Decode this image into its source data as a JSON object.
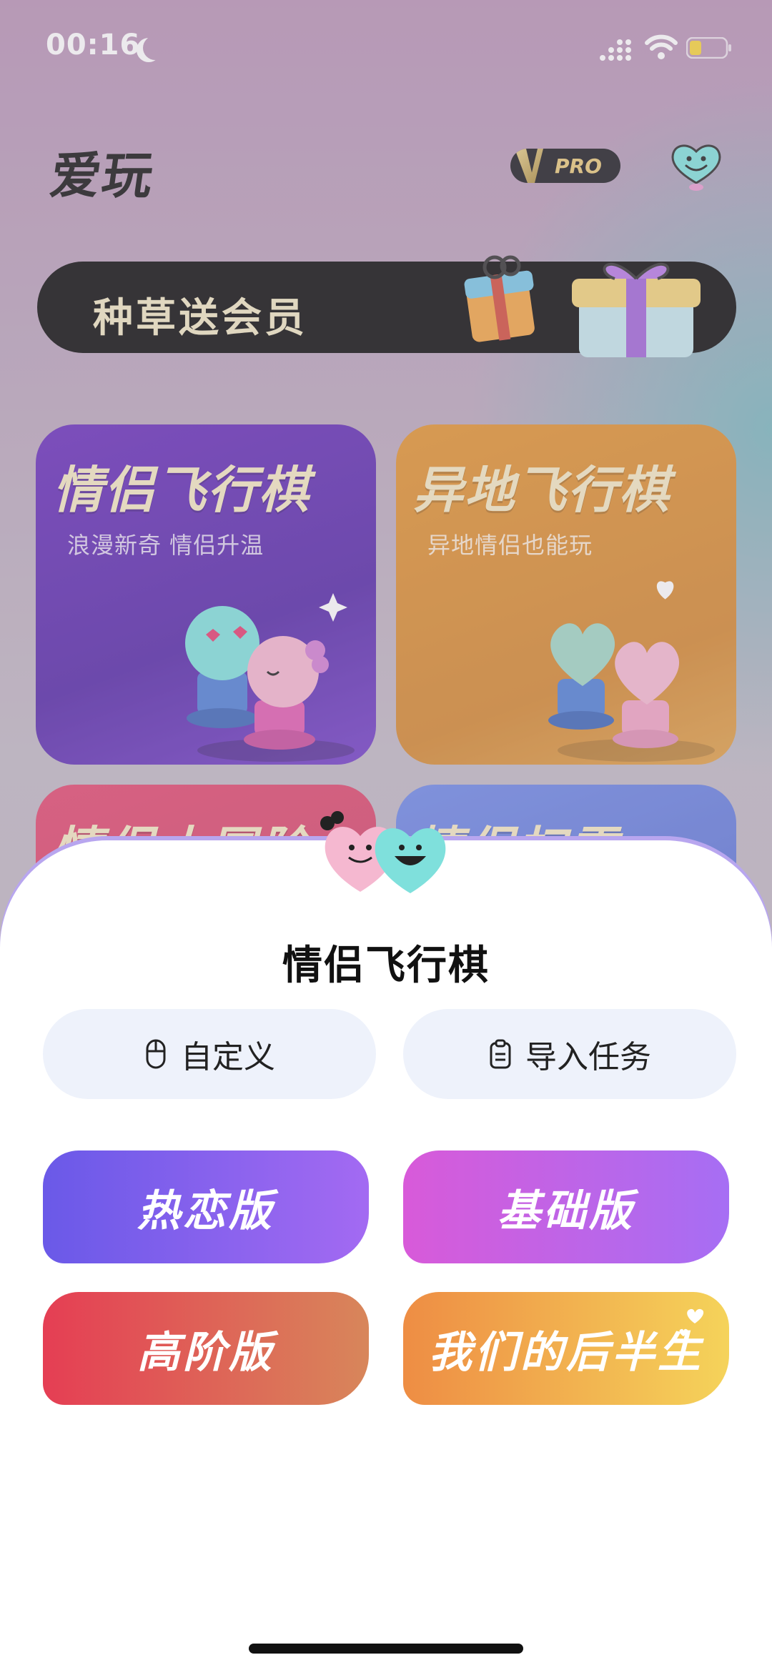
{
  "status_bar": {
    "time": "00:16"
  },
  "header": {
    "app_title": "爱玩",
    "pro_label": "PRO"
  },
  "banner": {
    "text": "种草送会员"
  },
  "cards": [
    {
      "title": "情侣飞行棋",
      "subtitle": "浪漫新奇 情侣升温"
    },
    {
      "title": "异地飞行棋",
      "subtitle": "异地情侣也能玩"
    },
    {
      "title": "情侣大冒险",
      "subtitle": ""
    },
    {
      "title": "情侣扫雷",
      "subtitle": ""
    }
  ],
  "sheet": {
    "title": "情侣飞行棋",
    "options": [
      {
        "label": "自定义",
        "icon": "mouse-icon"
      },
      {
        "label": "导入任务",
        "icon": "clipboard-icon"
      }
    ],
    "modes": [
      "热恋版",
      "基础版",
      "高阶版",
      "我们的后半生"
    ]
  },
  "colors": {
    "accent_purple": "#6a59e8",
    "accent_pink": "#d85ad9",
    "accent_red": "#e53e54",
    "accent_orange": "#ee8d44"
  }
}
